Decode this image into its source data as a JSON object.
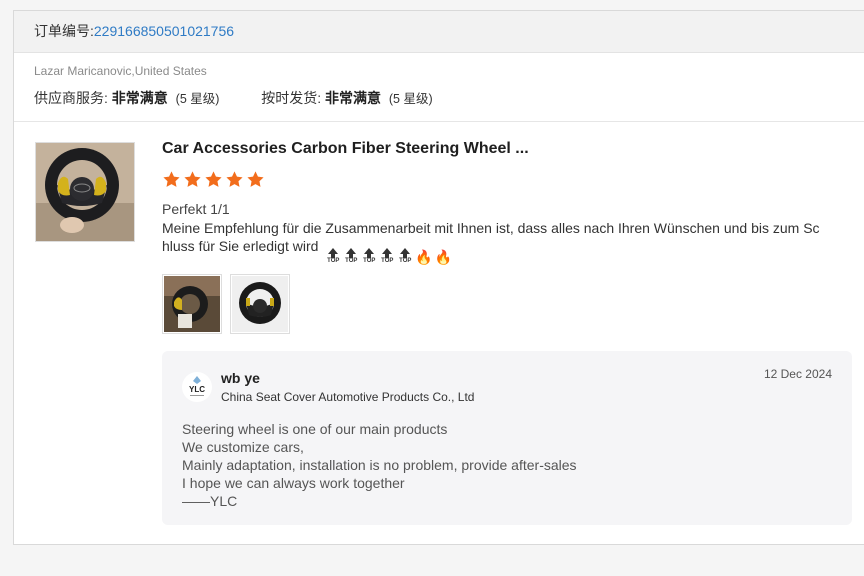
{
  "order": {
    "label": "订单编号:",
    "id": "229166850501021756"
  },
  "buyer": "Lazar Maricanovic,United States",
  "ratings": {
    "supplier_label": "供应商服务:",
    "supplier_value": "非常满意",
    "supplier_level": "(5 星级)",
    "shipping_label": "按时发货:",
    "shipping_value": "非常满意",
    "shipping_level": "(5 星级)"
  },
  "product": {
    "title": "Car Accessories Carbon Fiber Steering Wheel ...",
    "stars": 5,
    "star_color": "#f26d1c"
  },
  "review": {
    "heading": "Perfekt 1/1",
    "body": "Meine Empfehlung für die Zusammenarbeit mit Ihnen ist, dass alles nach Ihren Wünschen und bis zum Schluss für Sie erledigt wird",
    "top_icon_label": "TOP",
    "emojis": [
      "top-icon",
      "top-icon",
      "top-icon",
      "top-icon",
      "top-icon",
      "fire-icon",
      "fire-icon"
    ]
  },
  "reply": {
    "logo_text": "YLC",
    "name": "wb ye",
    "company": "China Seat Cover Automotive Products Co., Ltd",
    "date": "12 Dec 2024",
    "lines": [
      "Steering wheel is one of our main products",
      "We customize cars,",
      "Mainly adaptation, installation is no problem, provide after-sales",
      "I hope we can always work together",
      "——YLC"
    ]
  }
}
